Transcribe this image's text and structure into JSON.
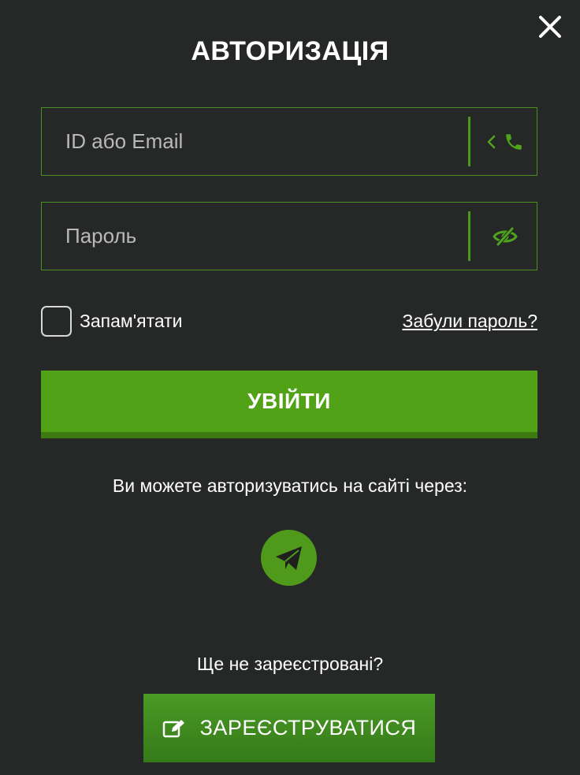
{
  "modal": {
    "title": "АВТОРИЗАЦІЯ",
    "close_icon": "close-icon"
  },
  "login_field": {
    "placeholder": "ID або Email",
    "value": "",
    "addon_icons": [
      "chevron-left-icon",
      "phone-icon"
    ]
  },
  "password_field": {
    "placeholder": "Пароль",
    "value": "",
    "addon_icon": "eye-hidden-icon"
  },
  "remember": {
    "label": "Запам'ятати",
    "checked": false
  },
  "forgot_link": "Забули пароль?",
  "login_button": "УВІЙТИ",
  "social": {
    "text": "Ви можете авторизуватись на сайті через:",
    "providers": [
      "telegram-icon"
    ]
  },
  "register": {
    "question": "Ще не зареєстровані?",
    "button_label": "ЗАРЕЄСТРУВАТИСЯ",
    "button_icon": "edit-icon"
  },
  "colors": {
    "background": "#262727",
    "accent": "#51a216",
    "accent_dark": "#3d7a12",
    "field_border": "#4c8f1f"
  }
}
